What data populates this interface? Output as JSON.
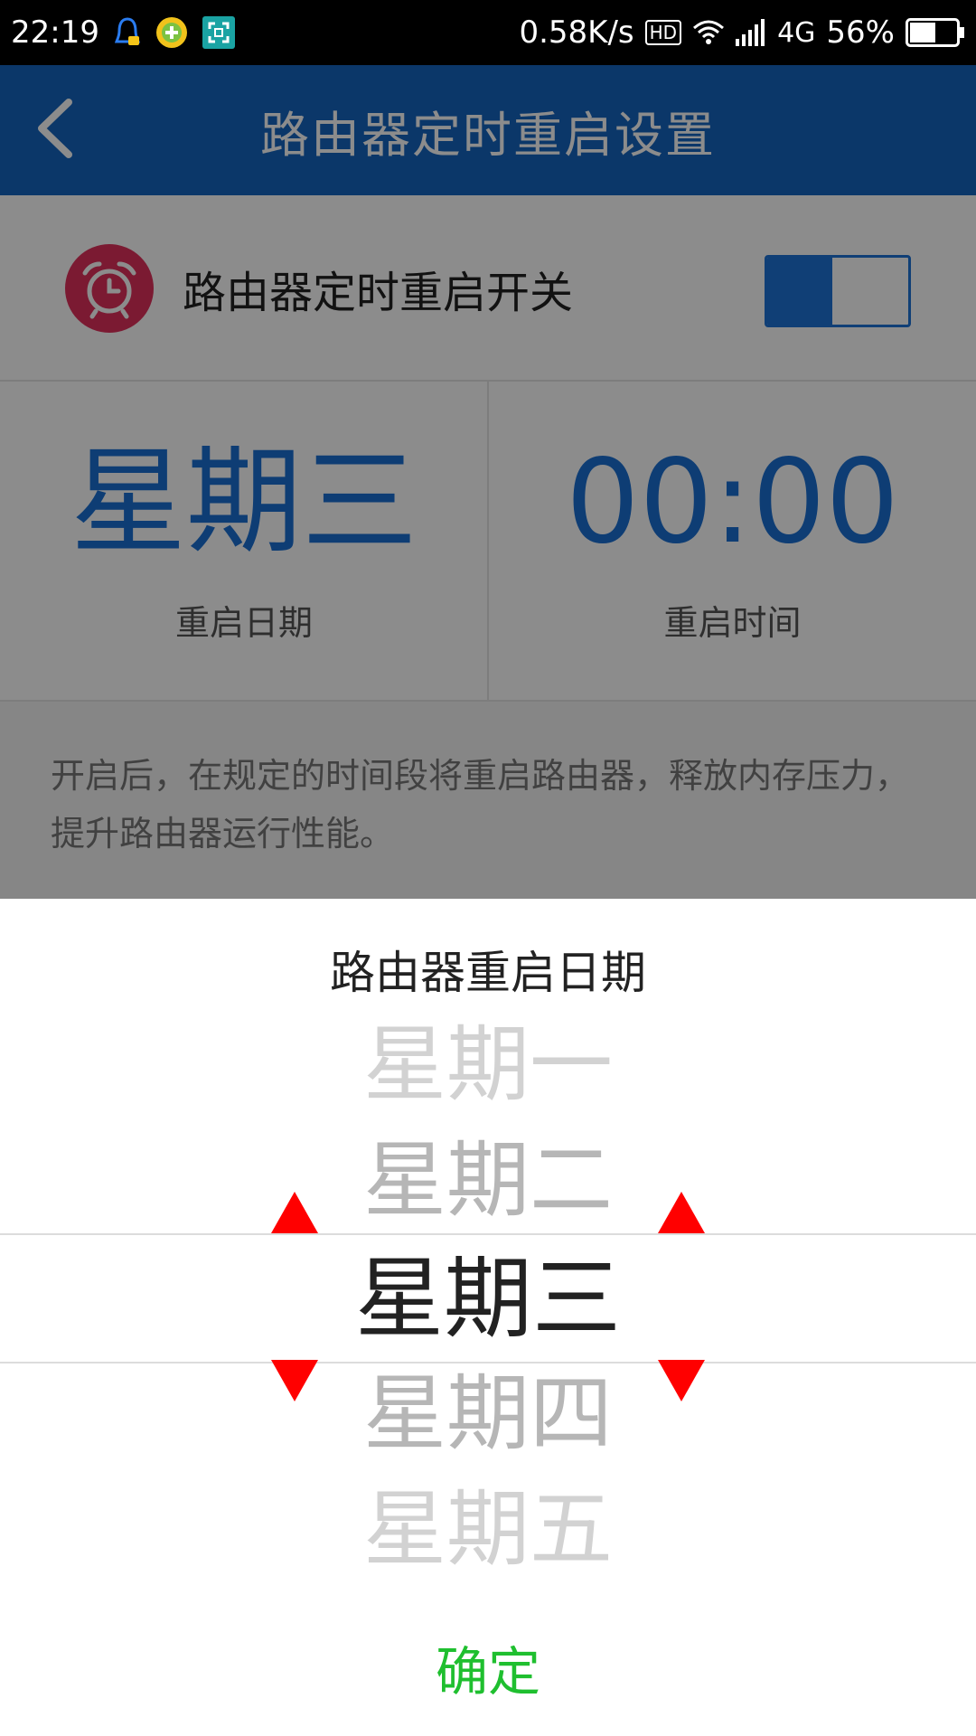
{
  "status_bar": {
    "time": "22:19",
    "net_speed": "0.58K/s",
    "hd_badge": "HD",
    "network_type": "4G",
    "battery_percent": "56%",
    "battery_level": 0.56,
    "icons": [
      "qq-notify-icon",
      "add-icon",
      "scan-icon",
      "hd-icon",
      "wifi-icon",
      "signal-icon",
      "battery-icon"
    ]
  },
  "header": {
    "title": "路由器定时重启设置",
    "back_icon": "back-chevron-icon"
  },
  "switch_row": {
    "label": "路由器定时重启开关",
    "icon": "alarm-clock-icon",
    "enabled": true
  },
  "schedule": {
    "date_value": "星期三",
    "date_caption": "重启日期",
    "time_value": "00:00",
    "time_caption": "重启时间"
  },
  "description": "开启后，在规定的时间段将重启路由器，释放内存压力，提升路由器运行性能。",
  "picker": {
    "title": "路由器重启日期",
    "items": [
      "星期一",
      "星期二",
      "星期三",
      "星期四",
      "星期五"
    ],
    "selected": "星期三",
    "confirm_label": "确定"
  },
  "colors": {
    "header_bg": "#1565c0",
    "accent_blue": "#1a6fd4",
    "alarm_icon_bg": "#e1315b",
    "confirm_green": "#1fbf2f",
    "arrow_red": "#ff0000"
  }
}
